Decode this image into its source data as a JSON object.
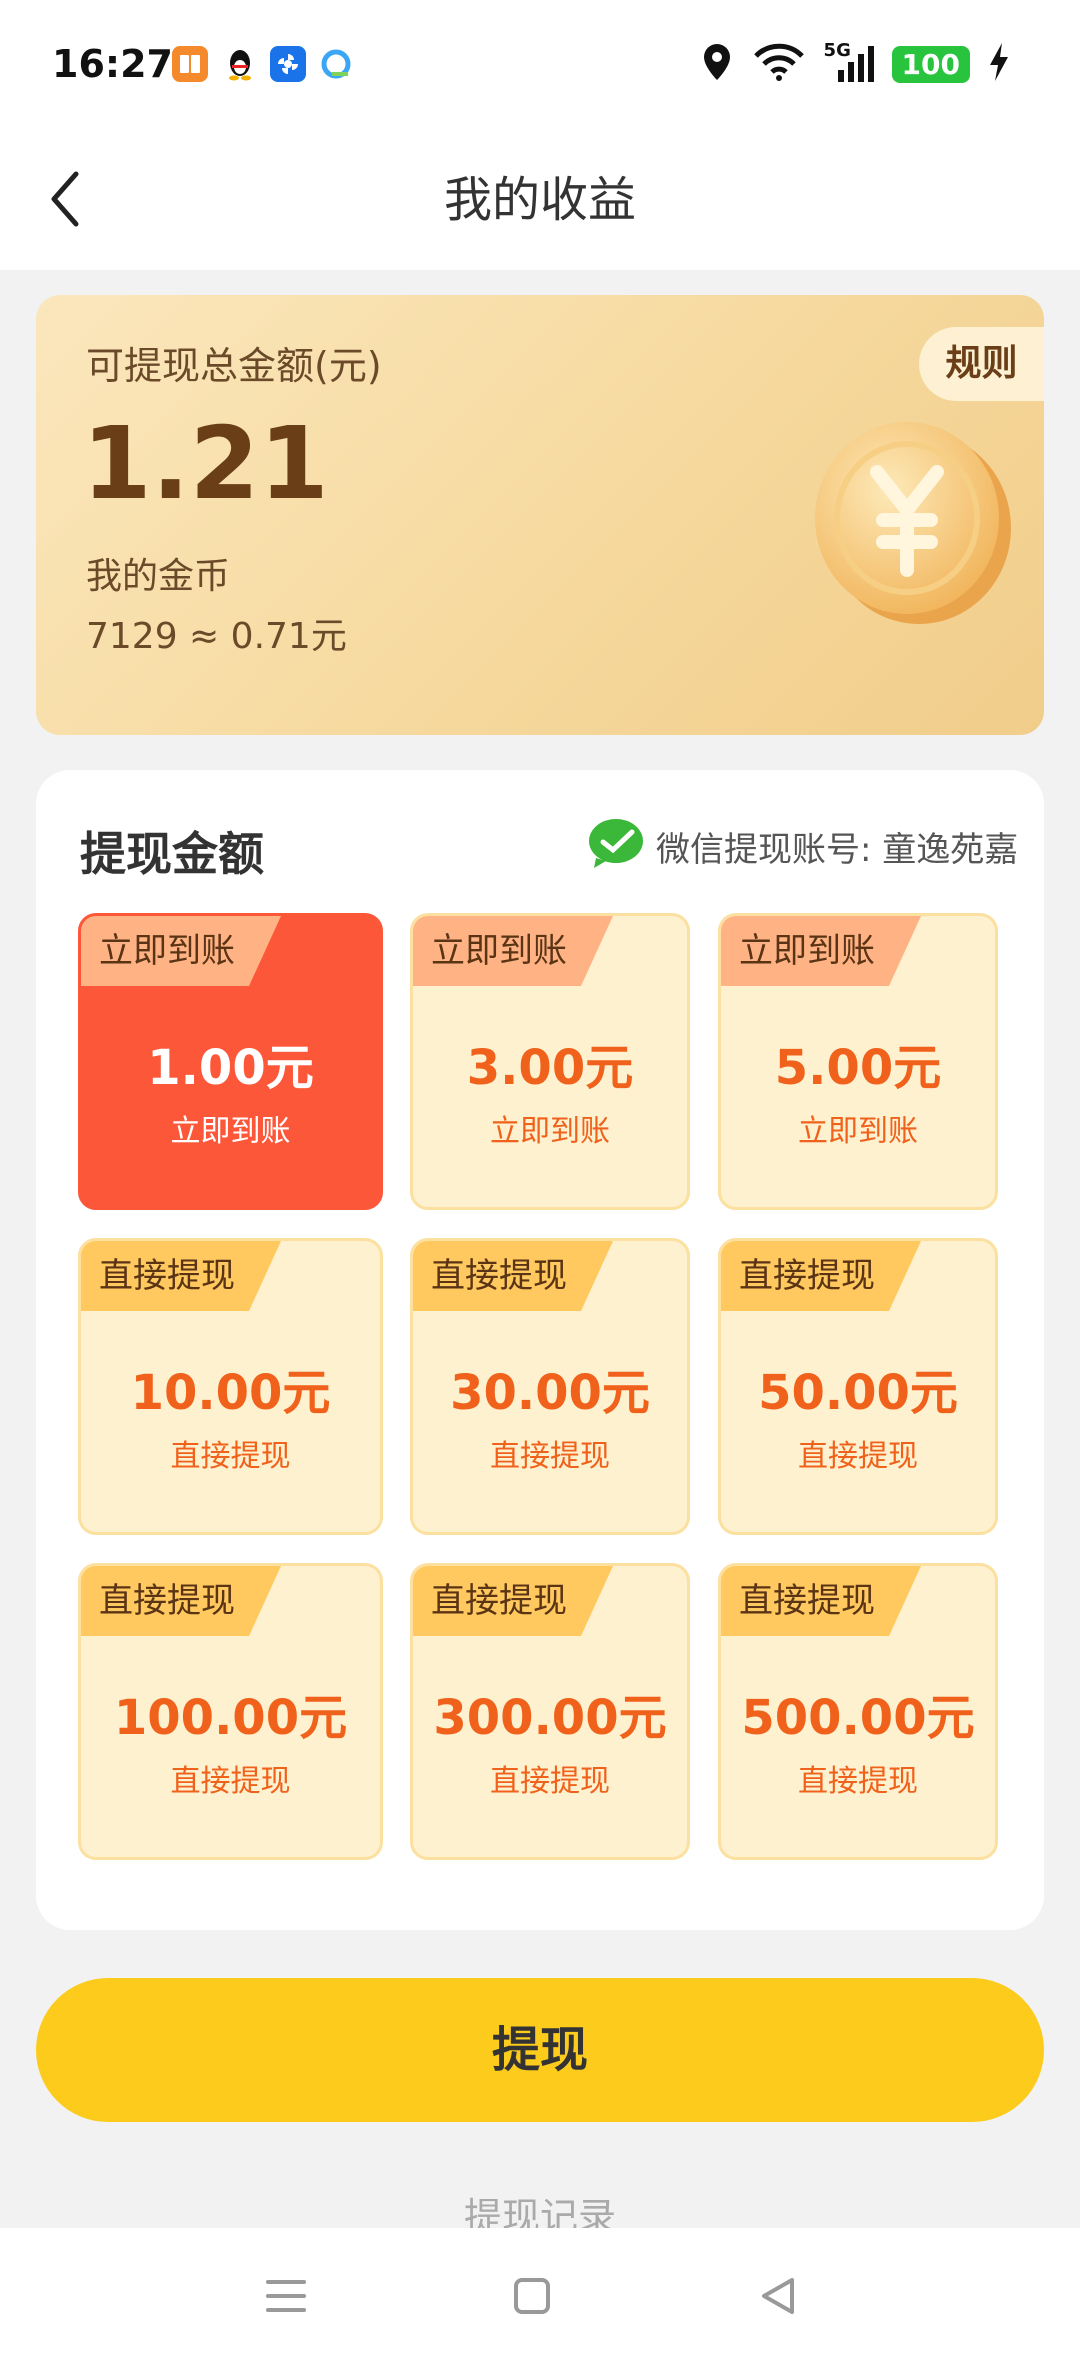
{
  "status_bar": {
    "time": "16:27",
    "network": "5G",
    "battery": "100",
    "notification_icons": [
      "books-app-icon",
      "qq-penguin-icon",
      "pinwheel-app-icon",
      "browser-app-icon"
    ]
  },
  "header": {
    "title": "我的收益"
  },
  "earnings": {
    "label": "可提现总金额(元)",
    "amount": "1.21",
    "coins_label": "我的金币",
    "coins_value": "7129 ≈ 0.71元",
    "rules_label": "规则"
  },
  "withdraw": {
    "title": "提现金额",
    "account_text": "微信提现账号: 童逸苑嘉",
    "options": [
      {
        "tag": "立即到账",
        "amount": "1.00元",
        "sub": "立即到账",
        "selected": true
      },
      {
        "tag": "立即到账",
        "amount": "3.00元",
        "sub": "立即到账",
        "selected": false
      },
      {
        "tag": "立即到账",
        "amount": "5.00元",
        "sub": "立即到账",
        "selected": false
      },
      {
        "tag": "直接提现",
        "amount": "10.00元",
        "sub": "直接提现",
        "selected": false
      },
      {
        "tag": "直接提现",
        "amount": "30.00元",
        "sub": "直接提现",
        "selected": false
      },
      {
        "tag": "直接提现",
        "amount": "50.00元",
        "sub": "直接提现",
        "selected": false
      },
      {
        "tag": "直接提现",
        "amount": "100.00元",
        "sub": "直接提现",
        "selected": false
      },
      {
        "tag": "直接提现",
        "amount": "300.00元",
        "sub": "直接提现",
        "selected": false
      },
      {
        "tag": "直接提现",
        "amount": "500.00元",
        "sub": "直接提现",
        "selected": false
      }
    ]
  },
  "actions": {
    "withdraw_button": "提现",
    "records_link": "提现记录"
  },
  "colors": {
    "accent_yellow": "#fccb1c",
    "selected_red": "#fd573a",
    "amount_orange": "#f0621c",
    "option_bg": "#fef1cf"
  }
}
